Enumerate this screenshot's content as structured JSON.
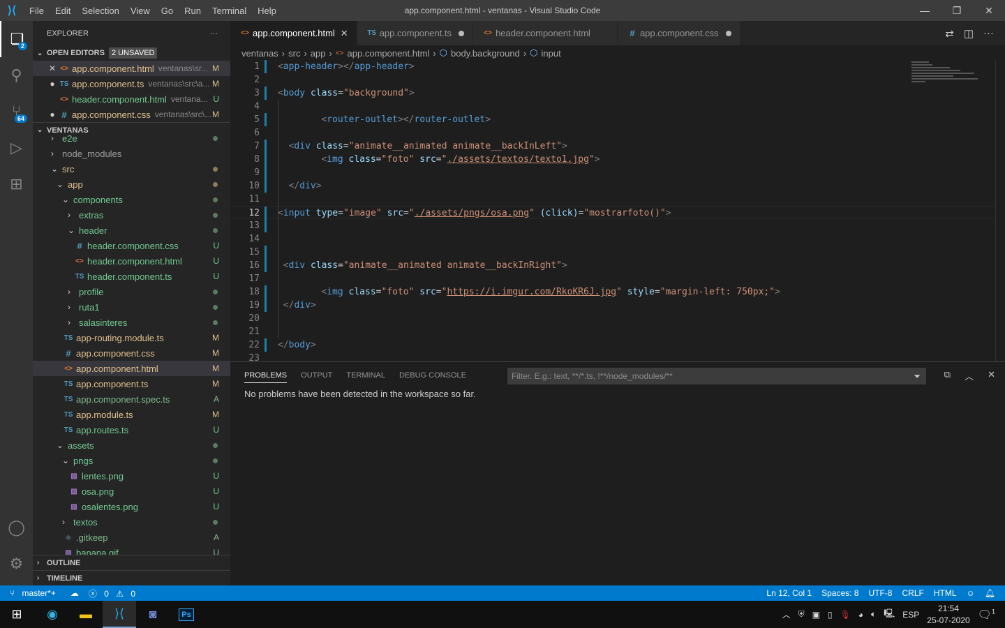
{
  "window": {
    "title": "app.component.html - ventanas - Visual Studio Code",
    "menu": [
      "File",
      "Edit",
      "Selection",
      "View",
      "Go",
      "Run",
      "Terminal",
      "Help"
    ]
  },
  "activity": {
    "explorer_badge": "2",
    "scm_badge": "64"
  },
  "sidebar": {
    "title": "EXPLORER",
    "open_editors": {
      "label": "OPEN EDITORS",
      "unsaved": "2 UNSAVED",
      "items": [
        {
          "name": "app.component.html",
          "path": "ventanas\\sr...",
          "status": "M",
          "icon": "html",
          "marker": "close"
        },
        {
          "name": "app.component.ts",
          "path": "ventanas\\src\\a...",
          "status": "M",
          "icon": "ts",
          "marker": "dot"
        },
        {
          "name": "header.component.html",
          "path": "ventana...",
          "status": "U",
          "icon": "html",
          "marker": ""
        },
        {
          "name": "app.component.css",
          "path": "ventanas\\src\\...",
          "status": "M",
          "icon": "css",
          "marker": "dot"
        }
      ]
    },
    "project": {
      "label": "VENTANAS",
      "items": [
        {
          "name": "e2e",
          "type": "folder",
          "open": false,
          "level": 0,
          "color": "U",
          "dot": "#5a7b60"
        },
        {
          "name": "node_modules",
          "type": "folder",
          "open": false,
          "level": 0,
          "color": "g",
          "dot": ""
        },
        {
          "name": "src",
          "type": "folder",
          "open": true,
          "level": 0,
          "color": "M",
          "dot": "#8c7b5f"
        },
        {
          "name": "app",
          "type": "folder",
          "open": true,
          "level": 1,
          "color": "M",
          "dot": "#8c7b5f"
        },
        {
          "name": "components",
          "type": "folder",
          "open": true,
          "level": 2,
          "color": "U",
          "dot": "#5a7b60"
        },
        {
          "name": "extras",
          "type": "folder",
          "open": false,
          "level": 3,
          "color": "U",
          "dot": "#5a7b60"
        },
        {
          "name": "header",
          "type": "folder",
          "open": true,
          "level": 3,
          "color": "U",
          "dot": "#5a7b60"
        },
        {
          "name": "header.component.css",
          "type": "file",
          "icon": "css",
          "level": 4,
          "color": "U",
          "status": "U"
        },
        {
          "name": "header.component.html",
          "type": "file",
          "icon": "html",
          "level": 4,
          "color": "U",
          "status": "U"
        },
        {
          "name": "header.component.ts",
          "type": "file",
          "icon": "ts",
          "level": 4,
          "color": "U",
          "status": "U"
        },
        {
          "name": "profile",
          "type": "folder",
          "open": false,
          "level": 3,
          "color": "U",
          "dot": "#5a7b60"
        },
        {
          "name": "ruta1",
          "type": "folder",
          "open": false,
          "level": 3,
          "color": "U",
          "dot": "#5a7b60"
        },
        {
          "name": "salasinteres",
          "type": "folder",
          "open": false,
          "level": 3,
          "color": "U",
          "dot": "#5a7b60"
        },
        {
          "name": "app-routing.module.ts",
          "type": "file",
          "icon": "ts",
          "level": 2,
          "color": "M",
          "status": "M"
        },
        {
          "name": "app.component.css",
          "type": "file",
          "icon": "css",
          "level": 2,
          "color": "M",
          "status": "M"
        },
        {
          "name": "app.component.html",
          "type": "file",
          "icon": "html",
          "level": 2,
          "color": "M",
          "status": "M",
          "selected": true
        },
        {
          "name": "app.component.ts",
          "type": "file",
          "icon": "ts",
          "level": 2,
          "color": "M",
          "status": "M"
        },
        {
          "name": "app.component.spec.ts",
          "type": "file",
          "icon": "ts",
          "level": 2,
          "color": "A",
          "status": "A"
        },
        {
          "name": "app.module.ts",
          "type": "file",
          "icon": "ts",
          "level": 2,
          "color": "M",
          "status": "M"
        },
        {
          "name": "app.routes.ts",
          "type": "file",
          "icon": "ts",
          "level": 2,
          "color": "U",
          "status": "U"
        },
        {
          "name": "assets",
          "type": "folder",
          "open": true,
          "level": 1,
          "color": "U",
          "dot": "#5a7b60"
        },
        {
          "name": "pngs",
          "type": "folder",
          "open": true,
          "level": 2,
          "color": "U",
          "dot": "#5a7b60"
        },
        {
          "name": "lentes.png",
          "type": "file",
          "icon": "png",
          "level": 3,
          "color": "U",
          "status": "U"
        },
        {
          "name": "osa.png",
          "type": "file",
          "icon": "png",
          "level": 3,
          "color": "U",
          "status": "U"
        },
        {
          "name": "osalentes.png",
          "type": "file",
          "icon": "png",
          "level": 3,
          "color": "U",
          "status": "U"
        },
        {
          "name": "textos",
          "type": "folder",
          "open": false,
          "level": 2,
          "color": "U",
          "dot": "#5a7b60"
        },
        {
          "name": ".gitkeep",
          "type": "file",
          "icon": "git",
          "level": 2,
          "color": "A",
          "status": "A"
        },
        {
          "name": "banana.gif",
          "type": "file",
          "icon": "png",
          "level": 2,
          "color": "U",
          "status": "U"
        }
      ]
    },
    "outline": "OUTLINE",
    "timeline": "TIMELINE"
  },
  "tabs": [
    {
      "label": "app.component.html",
      "icon": "html",
      "active": true,
      "marker": "close"
    },
    {
      "label": "app.component.ts",
      "icon": "ts",
      "active": false,
      "marker": "dot"
    },
    {
      "label": "header.component.html",
      "icon": "html",
      "active": false,
      "marker": ""
    },
    {
      "label": "app.component.css",
      "icon": "css",
      "active": false,
      "marker": "dot"
    }
  ],
  "breadcrumb": [
    "ventanas",
    "src",
    "app",
    "app.component.html",
    "body.background",
    "input"
  ],
  "editor": {
    "current_line": 12,
    "lines": [
      {
        "n": 1,
        "mod": true,
        "indent": 0,
        "t": [
          [
            "br",
            "<"
          ],
          [
            "tag",
            "app-header"
          ],
          [
            "br",
            "></"
          ],
          [
            "tag",
            "app-header"
          ],
          [
            "br",
            ">"
          ]
        ]
      },
      {
        "n": 2,
        "indent": 0,
        "t": []
      },
      {
        "n": 3,
        "mod": true,
        "indent": 0,
        "t": [
          [
            "br",
            "<"
          ],
          [
            "tag",
            "body"
          ],
          [
            "eq",
            " "
          ],
          [
            "at",
            "class"
          ],
          [
            "eq",
            "="
          ],
          [
            "st",
            "\"background\""
          ],
          [
            "br",
            ">"
          ]
        ]
      },
      {
        "n": 4,
        "indent": 0,
        "t": []
      },
      {
        "n": 5,
        "mod": true,
        "indent": 8,
        "t": [
          [
            "br",
            "<"
          ],
          [
            "tag",
            "router-outlet"
          ],
          [
            "br",
            "></"
          ],
          [
            "tag",
            "router-outlet"
          ],
          [
            "br",
            ">"
          ]
        ]
      },
      {
        "n": 6,
        "indent": 0,
        "t": []
      },
      {
        "n": 7,
        "mod": true,
        "indent": 2,
        "t": [
          [
            "br",
            "<"
          ],
          [
            "tag",
            "div"
          ],
          [
            "eq",
            " "
          ],
          [
            "at",
            "class"
          ],
          [
            "eq",
            "="
          ],
          [
            "st",
            "\"animate__animated animate__backInLeft\""
          ],
          [
            "br",
            ">"
          ]
        ]
      },
      {
        "n": 8,
        "mod": true,
        "indent": 8,
        "t": [
          [
            "br",
            "<"
          ],
          [
            "tag",
            "img"
          ],
          [
            "eq",
            " "
          ],
          [
            "at",
            "class"
          ],
          [
            "eq",
            "="
          ],
          [
            "st",
            "\"foto\""
          ],
          [
            "eq",
            " "
          ],
          [
            "at",
            "src"
          ],
          [
            "eq",
            "="
          ],
          [
            "st",
            "\""
          ],
          [
            "lk",
            "./assets/textos/texto1.jpg"
          ],
          [
            "st",
            "\""
          ],
          [
            "br",
            ">"
          ]
        ]
      },
      {
        "n": 9,
        "mod": true,
        "indent": 0,
        "t": []
      },
      {
        "n": 10,
        "mod": true,
        "indent": 2,
        "t": [
          [
            "br",
            "</"
          ],
          [
            "tag",
            "div"
          ],
          [
            "br",
            ">"
          ]
        ]
      },
      {
        "n": 11,
        "indent": 0,
        "t": []
      },
      {
        "n": 12,
        "mod": true,
        "indent": 0,
        "t": [
          [
            "br",
            "<"
          ],
          [
            "tag",
            "input"
          ],
          [
            "eq",
            " "
          ],
          [
            "at",
            "type"
          ],
          [
            "eq",
            "="
          ],
          [
            "st",
            "\"image\""
          ],
          [
            "eq",
            " "
          ],
          [
            "at",
            "src"
          ],
          [
            "eq",
            "="
          ],
          [
            "st",
            "\""
          ],
          [
            "lk",
            "./assets/pngs/osa.png"
          ],
          [
            "st",
            "\""
          ],
          [
            "eq",
            " "
          ],
          [
            "at",
            "(click)"
          ],
          [
            "eq",
            "="
          ],
          [
            "st",
            "\"mostrarfoto()\""
          ],
          [
            "br",
            ">"
          ]
        ]
      },
      {
        "n": 13,
        "mod": true,
        "indent": 0,
        "t": []
      },
      {
        "n": 14,
        "indent": 0,
        "t": []
      },
      {
        "n": 15,
        "mod": true,
        "indent": 0,
        "t": []
      },
      {
        "n": 16,
        "mod": true,
        "indent": 1,
        "t": [
          [
            "br",
            "<"
          ],
          [
            "tag",
            "div"
          ],
          [
            "eq",
            " "
          ],
          [
            "at",
            "class"
          ],
          [
            "eq",
            "="
          ],
          [
            "st",
            "\"animate__animated animate__backInRight\""
          ],
          [
            "br",
            ">"
          ]
        ]
      },
      {
        "n": 17,
        "indent": 0,
        "t": []
      },
      {
        "n": 18,
        "mod": true,
        "indent": 8,
        "t": [
          [
            "br",
            "<"
          ],
          [
            "tag",
            "img"
          ],
          [
            "eq",
            " "
          ],
          [
            "at",
            "class"
          ],
          [
            "eq",
            "="
          ],
          [
            "st",
            "\"foto\""
          ],
          [
            "eq",
            " "
          ],
          [
            "at",
            "src"
          ],
          [
            "eq",
            "="
          ],
          [
            "st",
            "\""
          ],
          [
            "lk",
            "https://i.imgur.com/RkoKR6J.jpg"
          ],
          [
            "st",
            "\""
          ],
          [
            "eq",
            " "
          ],
          [
            "at",
            "style"
          ],
          [
            "eq",
            "="
          ],
          [
            "st",
            "\"margin-left: 750px;\""
          ],
          [
            "br",
            ">"
          ]
        ]
      },
      {
        "n": 19,
        "mod": true,
        "indent": 1,
        "t": [
          [
            "br",
            "</"
          ],
          [
            "tag",
            "div"
          ],
          [
            "br",
            ">"
          ]
        ]
      },
      {
        "n": 20,
        "indent": 0,
        "t": []
      },
      {
        "n": 21,
        "indent": 0,
        "t": []
      },
      {
        "n": 22,
        "mod": true,
        "indent": 0,
        "t": [
          [
            "br",
            "</"
          ],
          [
            "tag",
            "body"
          ],
          [
            "br",
            ">"
          ]
        ]
      },
      {
        "n": 23,
        "indent": 0,
        "t": []
      }
    ]
  },
  "panel": {
    "tabs": [
      "PROBLEMS",
      "OUTPUT",
      "TERMINAL",
      "DEBUG CONSOLE"
    ],
    "filter_placeholder": "Filter. E.g.: text, **/*.ts, !**/node_modules/**",
    "message": "No problems have been detected in the workspace so far."
  },
  "status": {
    "branch": "master*+",
    "errors": "0",
    "warnings": "0",
    "position": "Ln 12, Col 1",
    "spaces": "Spaces: 8",
    "encoding": "UTF-8",
    "eol": "CRLF",
    "language": "HTML"
  },
  "taskbar": {
    "lang": "ESP",
    "time": "21:54",
    "date": "25-07-2020",
    "notifications": "1"
  },
  "colors": {
    "accent": "#007acc",
    "modified": "#e2c08d",
    "untracked": "#73c991",
    "added": "#81b88b"
  }
}
